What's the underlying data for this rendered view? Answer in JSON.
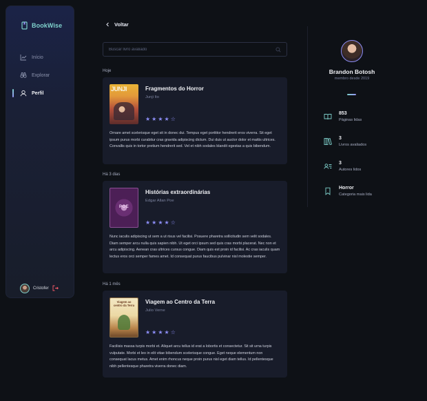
{
  "app": {
    "name": "BookWise"
  },
  "sidebar": {
    "items": [
      {
        "label": "Início",
        "icon": "chart-line-icon",
        "active": false
      },
      {
        "label": "Explorar",
        "icon": "binoculars-icon",
        "active": false
      },
      {
        "label": "Perfil",
        "icon": "user-icon",
        "active": true
      }
    ],
    "user": {
      "name": "Cristofer"
    }
  },
  "main": {
    "back_label": "Voltar",
    "search": {
      "placeholder": "Buscar livro avaliado",
      "value": ""
    },
    "groups": [
      {
        "label": "Hoje",
        "review": {
          "title": "Fragmentos do Horror",
          "author": "Junji Ito",
          "rating": 4,
          "max_rating": 5,
          "text": "Ornare amet scelerisque eget sit in donec dui. Tempus eget porttitor hendrerit eros viverra. Sit eget ipsum purus morbi curabitur cras gravida adipiscing dictum. Dui duis ut auctor dolor et mattis ultrices. Convallis quis in tortor pretium hendrerit sed. Vel et nibh sodales blandit egestas a quis bibendum."
        }
      },
      {
        "label": "Há 3 dias",
        "review": {
          "title": "Histórias extraordinárias",
          "author": "Edgar Allan Poe",
          "rating": 4,
          "max_rating": 5,
          "text": "Nunc iaculis adipiscing ut sem a ut risus vel facilisi. Posuere pharetra sollicitudin sem velit sodales. Diam semper arcu nulla quis sapien nibh. Ut eget orci ipsum sed quis cras morbi placerat. Nec non et arcu adipiscing. Aenean cras ultrices cursus congue. Diam quis est proin id facilisi. Ac cras iaculis quam lectus eros orci semper fames amet. Id consequat purus faucibus pulvinar nisl molestie semper."
        }
      },
      {
        "label": "Há 1 mês",
        "review": {
          "title": "Viagem ao Centro da Terra",
          "author": "Julio Verne",
          "rating": 4,
          "max_rating": 5,
          "text": "Facilisis massa turpis morbi et. Aliquet arcu tellus id erat a lobortis et consectetur. Sit sit urna turpis vulputate. Morbi et leo in elit vitae bibendum scelerisque congue. Eget neque elementum non consequat lacus metus. Amet enim rhoncus neque proin purus nisl eget diam tellus. Id pellentesque nibh pellentesque pharetra viverra donec diam."
        }
      }
    ]
  },
  "profile": {
    "name": "Brandon Botosh",
    "since": "membro desde 2019",
    "stats": [
      {
        "value": "853",
        "label": "Páginas lidas",
        "icon": "book-open-icon"
      },
      {
        "value": "3",
        "label": "Livros avaliados",
        "icon": "books-icon"
      },
      {
        "value": "3",
        "label": "Autores lidos",
        "icon": "user-list-icon"
      },
      {
        "value": "Horror",
        "label": "Categoria mais lida",
        "icon": "bookmark-icon"
      }
    ]
  },
  "colors": {
    "accent_green": "#7fd1cc",
    "accent_purple": "#8d8ef7",
    "card_bg": "#181c2a",
    "page_bg": "#0e1116"
  }
}
